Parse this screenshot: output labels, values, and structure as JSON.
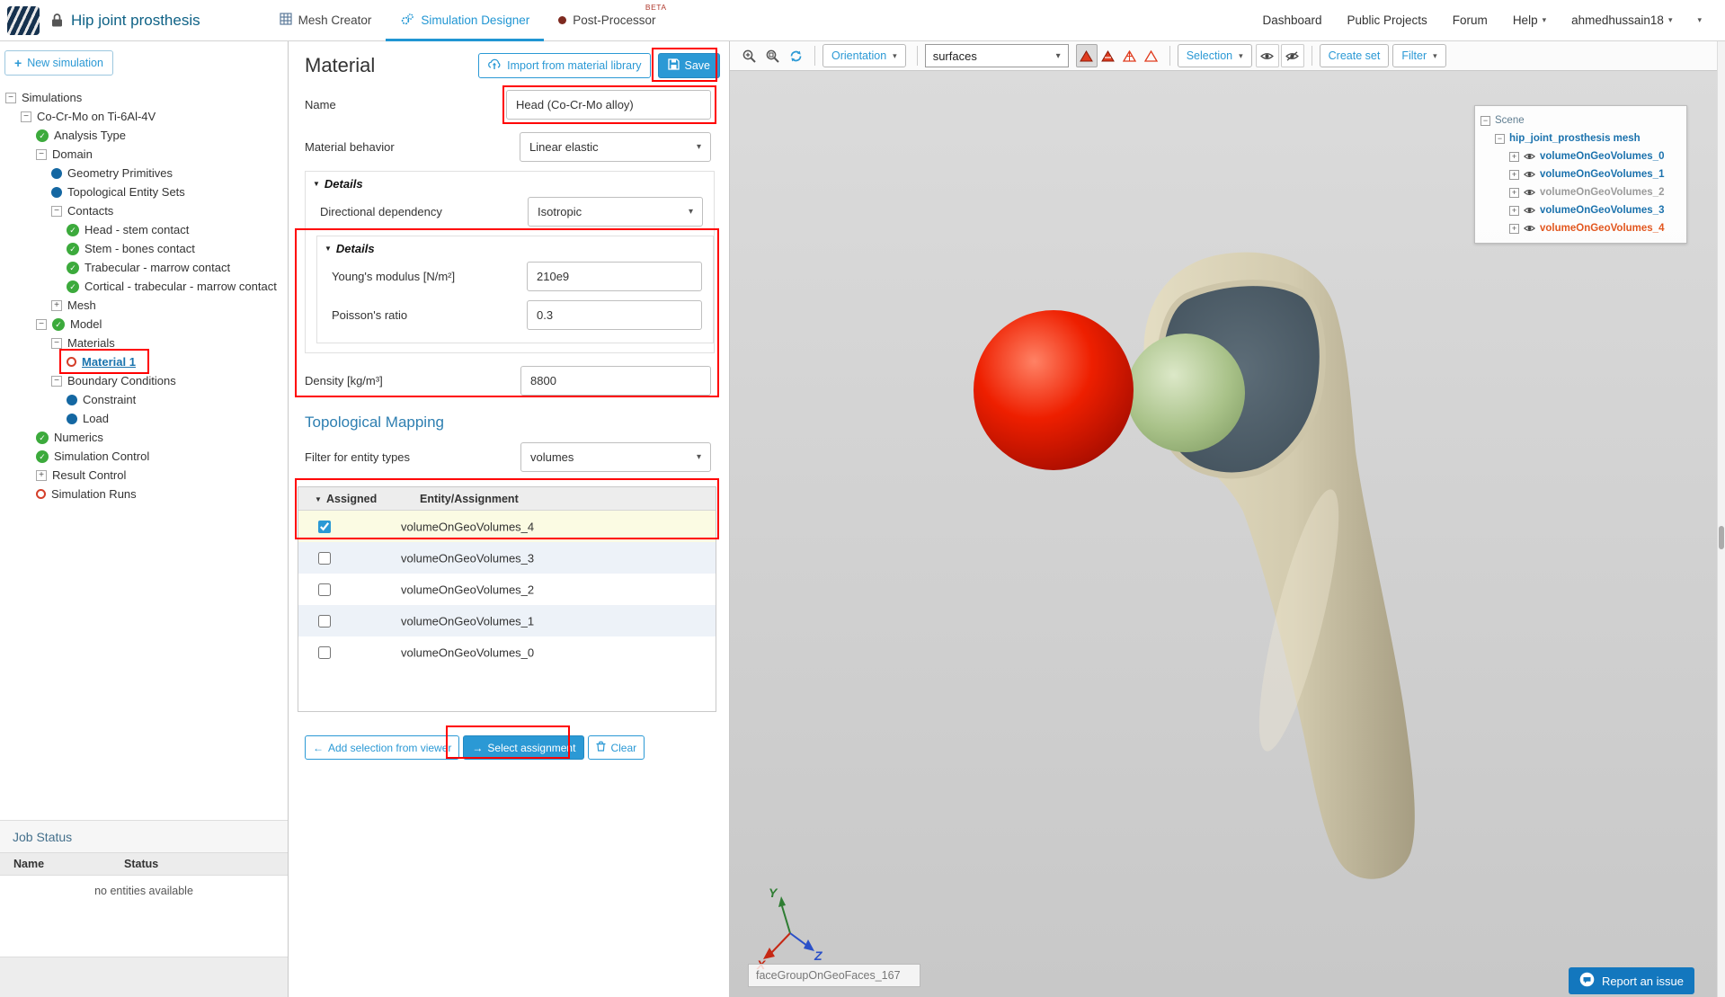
{
  "header": {
    "project_title": "Hip joint prosthesis",
    "tabs": [
      {
        "label": "Mesh Creator",
        "active": false,
        "badge": ""
      },
      {
        "label": "Simulation Designer",
        "active": true,
        "badge": ""
      },
      {
        "label": "Post-Processor",
        "active": false,
        "badge": "BETA"
      }
    ],
    "links": [
      "Dashboard",
      "Public Projects",
      "Forum"
    ],
    "help_label": "Help",
    "username": "ahmedhussain18"
  },
  "sidebar": {
    "new_simulation_label": "New simulation",
    "tree": [
      {
        "label": "Simulations",
        "level": 0,
        "expander": "minus",
        "icon": "none",
        "selected": false
      },
      {
        "label": "Co-Cr-Mo on Ti-6Al-4V",
        "level": 1,
        "expander": "minus",
        "icon": "none",
        "selected": false
      },
      {
        "label": "Analysis Type",
        "level": 2,
        "expander": "none",
        "icon": "check",
        "selected": false
      },
      {
        "label": "Domain",
        "level": 2,
        "expander": "minus",
        "icon": "none",
        "selected": false
      },
      {
        "label": "Geometry Primitives",
        "level": 3,
        "expander": "none",
        "icon": "dot",
        "selected": false
      },
      {
        "label": "Topological Entity Sets",
        "level": 3,
        "expander": "none",
        "icon": "dot",
        "selected": false
      },
      {
        "label": "Contacts",
        "level": 3,
        "expander": "minus",
        "icon": "none",
        "selected": false
      },
      {
        "label": "Head - stem contact",
        "level": 4,
        "expander": "none",
        "icon": "check",
        "selected": false
      },
      {
        "label": "Stem - bones contact",
        "level": 4,
        "expander": "none",
        "icon": "check",
        "selected": false
      },
      {
        "label": "Trabecular - marrow contact",
        "level": 4,
        "expander": "none",
        "icon": "check",
        "selected": false
      },
      {
        "label": "Cortical - trabecular - marrow contact",
        "level": 4,
        "expander": "none",
        "icon": "check",
        "selected": false
      },
      {
        "label": "Mesh",
        "level": 3,
        "expander": "plus",
        "icon": "none",
        "selected": false
      },
      {
        "label": "Model",
        "level": 2,
        "expander": "minus",
        "icon": "check",
        "selected": false
      },
      {
        "label": "Materials",
        "level": 3,
        "expander": "minus",
        "icon": "none",
        "selected": false
      },
      {
        "label": "Material 1",
        "level": 4,
        "expander": "none",
        "icon": "circle",
        "selected": true
      },
      {
        "label": "Boundary Conditions",
        "level": 3,
        "expander": "minus",
        "icon": "none",
        "selected": false
      },
      {
        "label": "Constraint",
        "level": 4,
        "expander": "none",
        "icon": "dot",
        "selected": false
      },
      {
        "label": "Load",
        "level": 4,
        "expander": "none",
        "icon": "dot",
        "selected": false
      },
      {
        "label": "Numerics",
        "level": 2,
        "expander": "none",
        "icon": "check",
        "selected": false
      },
      {
        "label": "Simulation Control",
        "level": 2,
        "expander": "none",
        "icon": "check",
        "selected": false
      },
      {
        "label": "Result Control",
        "level": 2,
        "expander": "plus",
        "icon": "none",
        "selected": false
      },
      {
        "label": "Simulation Runs",
        "level": 2,
        "expander": "none",
        "icon": "circle",
        "selected": false
      }
    ],
    "job_status": {
      "title": "Job Status",
      "columns": [
        "Name",
        "Status"
      ],
      "empty_message": "no entities available"
    }
  },
  "material_panel": {
    "title": "Material",
    "import_button": "Import from material library",
    "save_button": "Save",
    "name_label": "Name",
    "name_value": "Head (Co-Cr-Mo alloy)",
    "behavior_label": "Material behavior",
    "behavior_value": "Linear elastic",
    "details_label": "Details",
    "directional_label": "Directional dependency",
    "directional_value": "Isotropic",
    "inner_details_label": "Details",
    "youngs_label": "Young's modulus [N/m²]",
    "youngs_value": "210e9",
    "poisson_label": "Poisson's ratio",
    "poisson_value": "0.3",
    "density_label": "Density [kg/m³]",
    "density_value": "8800",
    "topological": {
      "title": "Topological Mapping",
      "filter_label": "Filter for entity types",
      "filter_value": "volumes",
      "col_assigned": "Assigned",
      "col_entity": "Entity/Assignment",
      "rows": [
        {
          "name": "volumeOnGeoVolumes_4",
          "checked": true
        },
        {
          "name": "volumeOnGeoVolumes_3",
          "checked": false
        },
        {
          "name": "volumeOnGeoVolumes_2",
          "checked": false
        },
        {
          "name": "volumeOnGeoVolumes_1",
          "checked": false
        },
        {
          "name": "volumeOnGeoVolumes_0",
          "checked": false
        }
      ],
      "add_selection_button": "Add selection from viewer",
      "select_assignment_button": "Select assignment",
      "clear_button": "Clear"
    }
  },
  "viewer": {
    "toolbar": {
      "orientation_label": "Orientation",
      "surfaces_value": "surfaces",
      "selection_label": "Selection",
      "create_set_label": "Create set",
      "filter_label": "Filter"
    },
    "scene_tree": [
      {
        "label": "Scene",
        "level": 0,
        "expander": "minus",
        "eye": false,
        "color": "gray"
      },
      {
        "label": "hip_joint_prosthesis mesh",
        "level": 1,
        "expander": "minus",
        "eye": false,
        "color": "blue"
      },
      {
        "label": "volumeOnGeoVolumes_0",
        "level": 2,
        "expander": "plus",
        "eye": true,
        "color": "blue"
      },
      {
        "label": "volumeOnGeoVolumes_1",
        "level": 2,
        "expander": "plus",
        "eye": true,
        "color": "blue"
      },
      {
        "label": "volumeOnGeoVolumes_2",
        "level": 2,
        "expander": "plus",
        "eye": true,
        "color": "muted"
      },
      {
        "label": "volumeOnGeoVolumes_3",
        "level": 2,
        "expander": "plus",
        "eye": true,
        "color": "blue"
      },
      {
        "label": "volumeOnGeoVolumes_4",
        "level": 2,
        "expander": "plus",
        "eye": true,
        "color": "orange"
      }
    ],
    "axis_labels": {
      "x": "X",
      "y": "Y",
      "z": "Z"
    },
    "selection_field_value": "faceGroupOnGeoFaces_167",
    "report_button": "Report an issue"
  },
  "colors": {
    "accent_blue": "#2b99d5",
    "heading_blue": "#2e7fb1",
    "scene_blue": "#1b72ad",
    "scene_orange": "#e2571f",
    "check_green": "#3caa3c",
    "dot_blue": "#1467a2",
    "incomplete_red": "#d43f2a",
    "annotation_red": "#ff0000",
    "prosthesis_head_red": "#ee1f00",
    "femoral_head_green": "#a9c289",
    "bone_tan": "#d3cbaf"
  }
}
